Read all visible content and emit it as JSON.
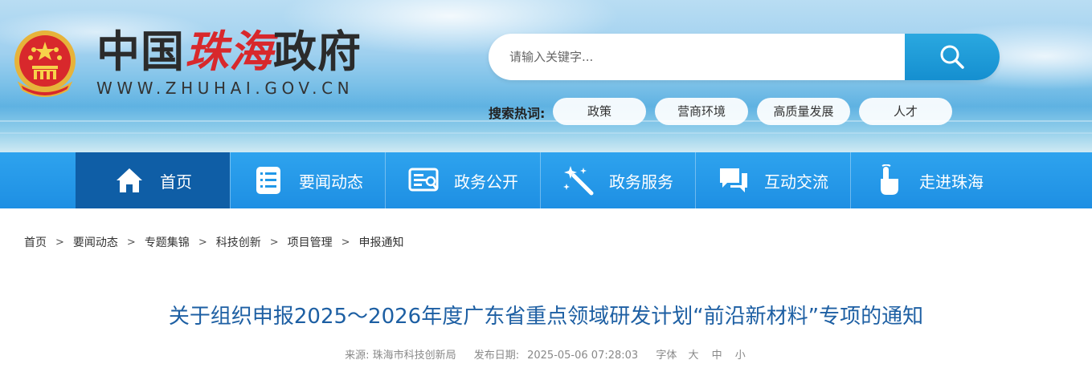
{
  "header": {
    "site_title_part1": "中国",
    "site_title_part2": "珠海",
    "site_title_part3": "政府",
    "domain": "WWW.ZHUHAI.GOV.CN",
    "search": {
      "placeholder": "请输入关键字..."
    },
    "hot_search_label": "搜索热词:",
    "hot_tags": [
      "政策",
      "营商环境",
      "高质量发展",
      "人才"
    ]
  },
  "nav": {
    "items": [
      {
        "label": "首页",
        "icon": "home-icon"
      },
      {
        "label": "要闻动态",
        "icon": "news-list-icon"
      },
      {
        "label": "政务公开",
        "icon": "document-icon"
      },
      {
        "label": "政务服务",
        "icon": "magic-wand-icon"
      },
      {
        "label": "互动交流",
        "icon": "chat-icon"
      },
      {
        "label": "走进珠海",
        "icon": "hand-pointer-icon"
      }
    ],
    "active_index": 0
  },
  "breadcrumb": [
    "首页",
    "要闻动态",
    "专题集锦",
    "科技创新",
    "项目管理",
    "申报通知"
  ],
  "article": {
    "title": "关于组织申报2025～2026年度广东省重点领域研发计划“前沿新材料”专项的通知",
    "source_label": "来源:",
    "source": "珠海市科技创新局",
    "date_label": "发布日期:",
    "date": "2025-05-06 07:28:03",
    "font_label": "字体",
    "font_sizes": [
      "大",
      "中",
      "小"
    ]
  },
  "colors": {
    "nav_bg": "#2ea3ee",
    "nav_active": "#0f5ea6",
    "title_blue": "#1d5fa3",
    "brand_red": "#d8282c",
    "search_btn": "#1e9ad8"
  }
}
